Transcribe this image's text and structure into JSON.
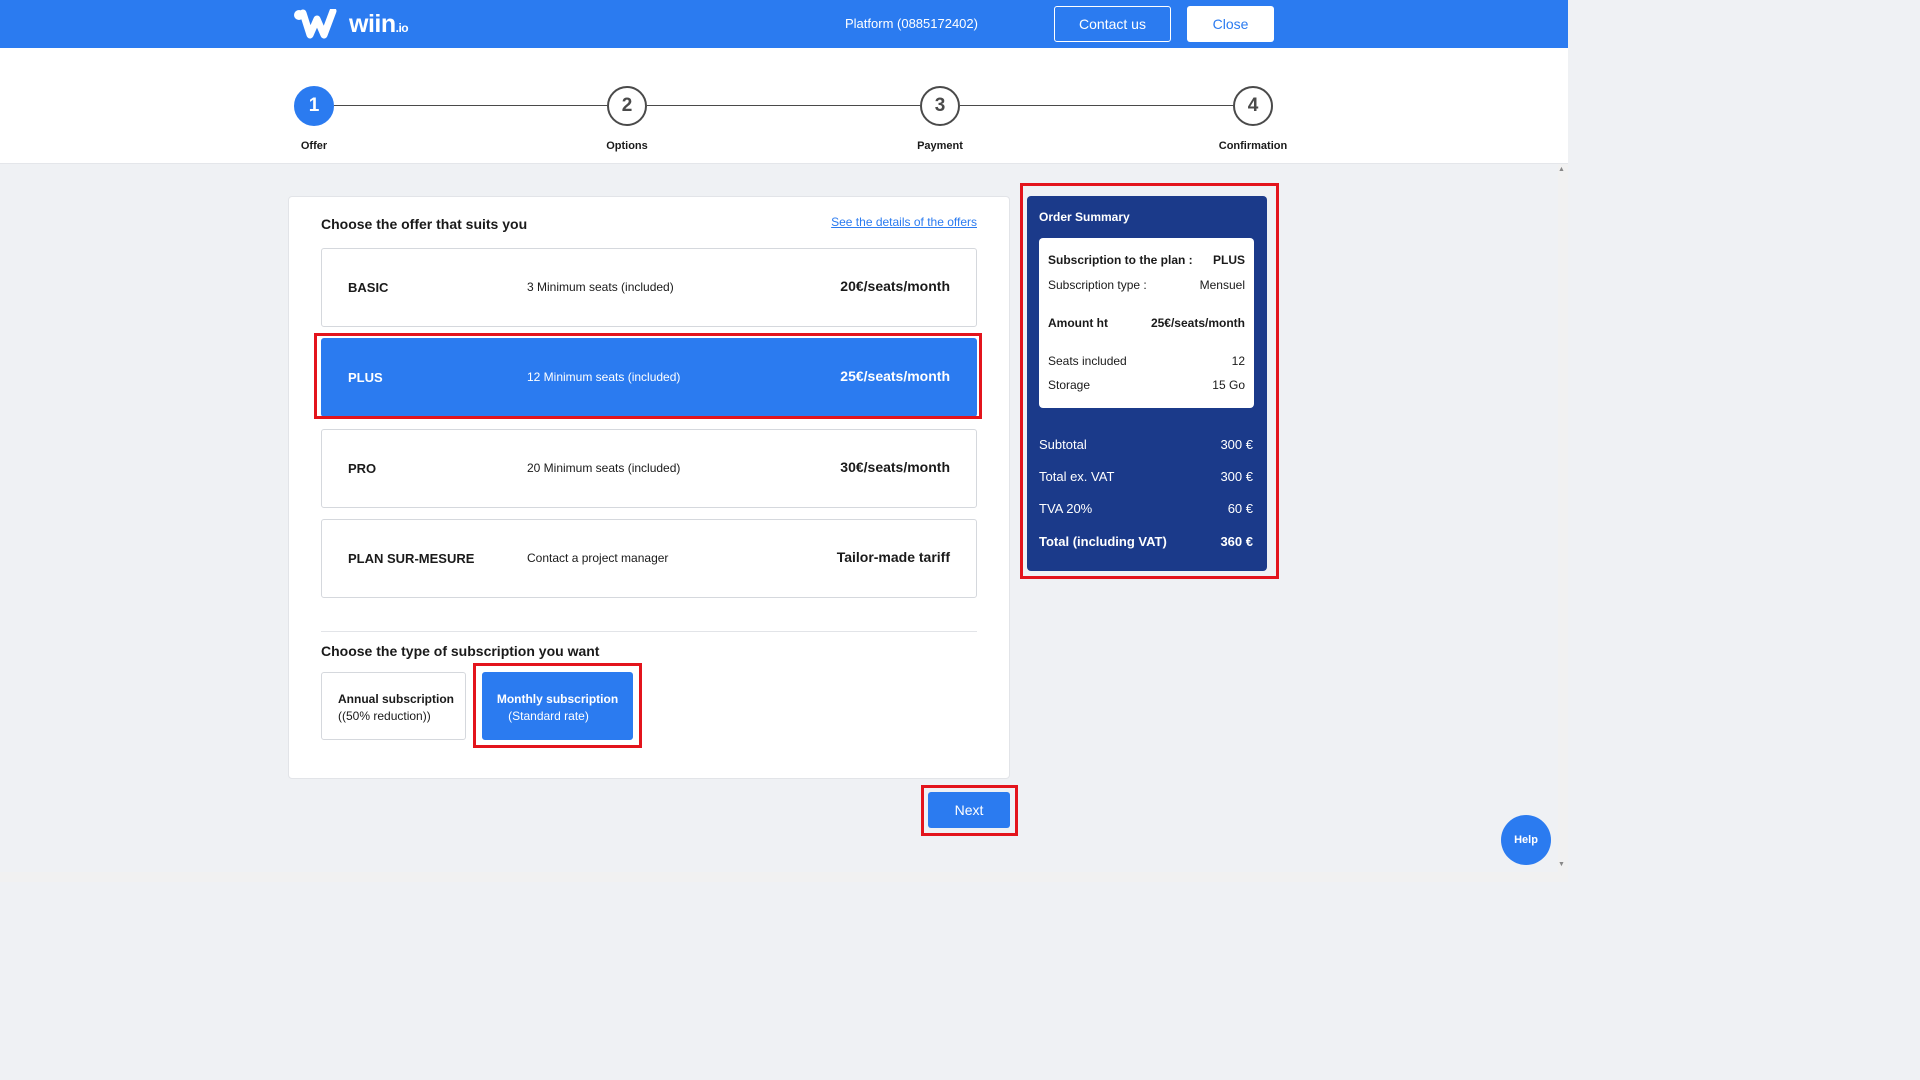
{
  "header": {
    "logo_text": "wiin",
    "logo_tld": ".io",
    "platform": "Platform (0885172402)",
    "contact_label": "Contact us",
    "close_label": "Close"
  },
  "stepper": {
    "steps": [
      {
        "number": "1",
        "label": "Offer",
        "active": true
      },
      {
        "number": "2",
        "label": "Options",
        "active": false
      },
      {
        "number": "3",
        "label": "Payment",
        "active": false
      },
      {
        "number": "4",
        "label": "Confirmation",
        "active": false
      }
    ]
  },
  "offers_section": {
    "title": "Choose the offer that suits you",
    "details_link": "See the details of the offers",
    "offers": [
      {
        "name": "BASIC",
        "seats": "3 Minimum seats (included)",
        "price": "20€/seats/month",
        "selected": false
      },
      {
        "name": "PLUS",
        "seats": "12 Minimum seats (included)",
        "price": "25€/seats/month",
        "selected": true
      },
      {
        "name": "PRO",
        "seats": "20 Minimum seats (included)",
        "price": "30€/seats/month",
        "selected": false
      },
      {
        "name": "PLAN SUR-MESURE",
        "seats": "Contact a project manager",
        "price": "Tailor-made tariff",
        "selected": false
      }
    ]
  },
  "subscription_section": {
    "title": "Choose the type of subscription you want",
    "annual": {
      "line1": "Annual subscription",
      "line2": "((50% reduction))"
    },
    "monthly": {
      "line1": "Monthly subscription",
      "line2": "(Standard rate)"
    }
  },
  "summary": {
    "title": "Order Summary",
    "plan_label": "Subscription to the plan :",
    "plan_value": "PLUS",
    "type_label": "Subscription type :",
    "type_value": "Mensuel",
    "amount_label": "Amount ht",
    "amount_value": "25€/seats/month",
    "seats_label": "Seats included",
    "seats_value": "12",
    "storage_label": "Storage",
    "storage_value": "15 Go",
    "subtotal_label": "Subtotal",
    "subtotal_value": "300 €",
    "total_ex_label": "Total ex. VAT",
    "total_ex_value": "300 €",
    "vat_label": "TVA 20%",
    "vat_value": "60 €",
    "total_label": "Total (including VAT)",
    "total_value": "360 €"
  },
  "actions": {
    "next_label": "Next",
    "help_label": "Help"
  },
  "colors": {
    "brand_blue": "#2b7bf0",
    "summary_navy": "#1b3a8a",
    "highlight_red": "#e3141c"
  }
}
